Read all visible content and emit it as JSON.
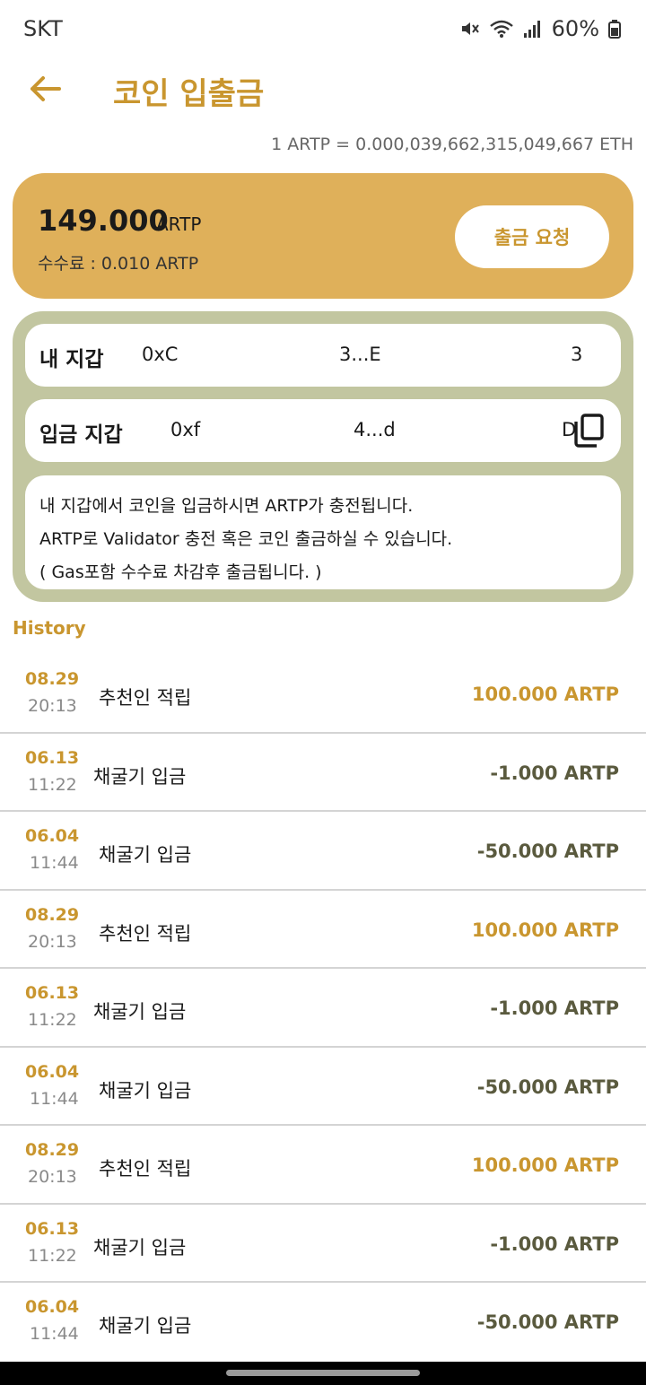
{
  "status": {
    "carrier": "SKT",
    "battery": "60%"
  },
  "header": {
    "title": "코인 입출금"
  },
  "rate": "1 ARTP = 0.000,039,662,315,049,667 ETH",
  "balance": {
    "amount": "149.000",
    "unit": "ARTP",
    "fee": "수수료 : 0.010 ARTP",
    "withdraw_label": "출금 요청"
  },
  "wallets": {
    "mine": {
      "label": "내 지갑",
      "part1": "0xC",
      "part2": "3...E",
      "part3": "3"
    },
    "deposit": {
      "label": "입금 지갑",
      "part1": "0xf",
      "part2": "4...d",
      "part3": "D"
    }
  },
  "notice": {
    "line1": "내 지갑에서 코인을 입금하시면 ARTP가 충전됩니다.",
    "line2": "ARTP로 Validator 충전 혹은 코인 출금하실 수 있습니다.",
    "line3": "( Gas포함 수수료 차감후 출금됩니다. )"
  },
  "history": {
    "label": "History",
    "items": [
      {
        "date": "08.29",
        "time": "20:13",
        "desc": "추천인 적립",
        "amount": "100.000 ARTP"
      },
      {
        "date": "06.13",
        "time": "11:22",
        "desc": "채굴기 입금",
        "amount": "-1.000 ARTP"
      },
      {
        "date": "06.04",
        "time": "11:44",
        "desc": "채굴기 입금",
        "amount": "-50.000 ARTP"
      },
      {
        "date": "08.29",
        "time": "20:13",
        "desc": "추천인 적립",
        "amount": "100.000 ARTP"
      },
      {
        "date": "06.13",
        "time": "11:22",
        "desc": "채굴기 입금",
        "amount": "-1.000 ARTP"
      },
      {
        "date": "06.04",
        "time": "11:44",
        "desc": "채굴기 입금",
        "amount": "-50.000 ARTP"
      },
      {
        "date": "08.29",
        "time": "20:13",
        "desc": "추천인 적립",
        "amount": "100.000 ARTP"
      },
      {
        "date": "06.13",
        "time": "11:22",
        "desc": "채굴기 입금",
        "amount": "-1.000 ARTP"
      },
      {
        "date": "06.04",
        "time": "11:44",
        "desc": "채굴기 입금",
        "amount": "-50.000 ARTP"
      }
    ]
  },
  "colors": {
    "accent": "#c9962f",
    "card": "#dfb05a",
    "panel": "#c2c6a0",
    "negative": "#5a5a3e"
  }
}
